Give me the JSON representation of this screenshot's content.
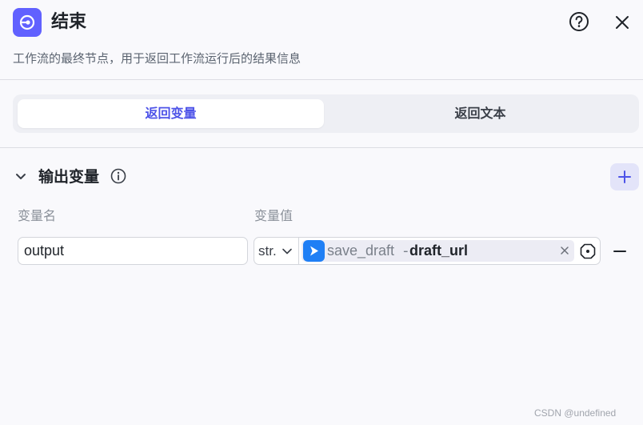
{
  "header": {
    "title": "结束",
    "description": "工作流的最终节点，用于返回工作流运行后的结果信息",
    "node_icon": "end-node-icon",
    "help_icon": "question-circle-icon",
    "close_icon": "close-icon"
  },
  "tabs": [
    {
      "label": "返回变量",
      "active": true
    },
    {
      "label": "返回文本",
      "active": false
    }
  ],
  "output_section": {
    "title": "输出变量",
    "info_icon": "info-circle-icon",
    "add_icon": "plus-icon",
    "columns": {
      "name": "变量名",
      "value": "变量值"
    },
    "rows": [
      {
        "name": "output",
        "type": "str.",
        "ref_node": "save_draft",
        "ref_separator": "-",
        "ref_variable": "draft_url",
        "ref_icon": "play-node-icon"
      }
    ]
  },
  "colors": {
    "accent": "#4d53e8",
    "node_icon_bg": "#6161ff",
    "ref_icon_bg": "#1f7ff5"
  },
  "watermark": "CSDN @undefined"
}
